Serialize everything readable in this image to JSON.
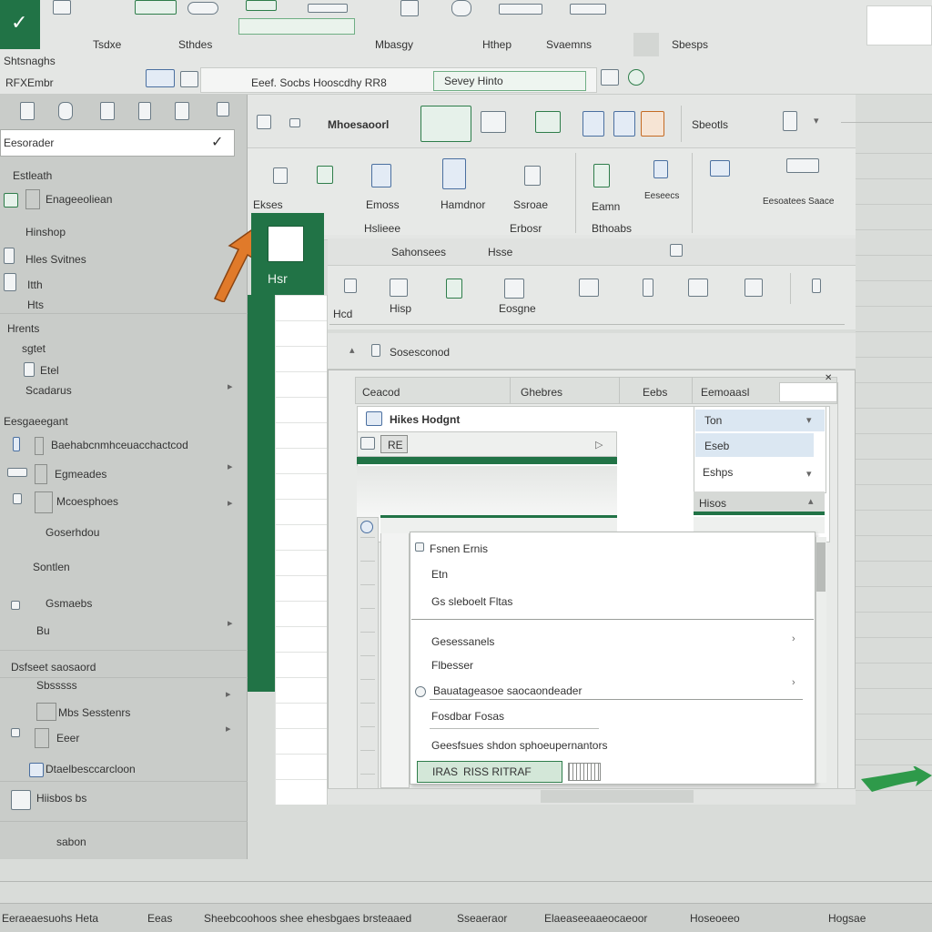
{
  "titlebar": {
    "logo_glyph": "✓",
    "menus": [
      "Tsdxe",
      "Sthdes",
      "Mbasgy",
      "Hthep",
      "Svaemns",
      "Sbesps"
    ]
  },
  "formula_bar": {
    "name_box": "Shtsnaghs",
    "sub_name": "RFXEmbr",
    "content": "Eeef. Socbs Hooscdhy RR8",
    "content2": "Sevey Hinto"
  },
  "left_pane": {
    "search_value": "Eesorader",
    "items": [
      {
        "label": "Estleath"
      },
      {
        "label": "Enageeoliean"
      },
      {
        "label": "Hinshop"
      },
      {
        "label": "Hles Svitnes"
      },
      {
        "label": "Itth"
      },
      {
        "label": "Hts"
      }
    ],
    "section2_title": "Hrents",
    "section2_items": [
      {
        "label": "sgtet"
      },
      {
        "label": "Etel"
      },
      {
        "label": "Scadarus"
      }
    ],
    "section3_title": "Eesgaeegant",
    "section3_items": [
      {
        "label": "Baehabcnmhceuacchactcod"
      },
      {
        "label": "Egmeades"
      },
      {
        "label": "Mcoesphoes"
      },
      {
        "label": "Goserhdou"
      },
      {
        "label": "Sontlen"
      },
      {
        "label": "Gsmaebs"
      },
      {
        "label": "Bu"
      }
    ],
    "section4_title": "Dsfseet saosaord",
    "section4_items": [
      {
        "label": "Sbsssss"
      },
      {
        "label": "Mbs Sesstenrs"
      },
      {
        "label": "Eeer"
      },
      {
        "label": "Dtaelbesccarcloon"
      },
      {
        "label": "Hiisbos bs"
      },
      {
        "label": "sabon"
      }
    ]
  },
  "ribbon": {
    "top_label": "Mhoesaoorl",
    "top_right_label": "Sbeotls",
    "groups": [
      {
        "label": "Emoss"
      },
      {
        "label": "Hamdnor"
      },
      {
        "label": "Ssroae"
      },
      {
        "label": "Eamn"
      },
      {
        "label": "Bthoabs"
      },
      {
        "label": "Eeseecs"
      },
      {
        "label": "Eesoatees Saace"
      }
    ],
    "group_captions": [
      "Ekses",
      "Hslieee",
      "Erbosr"
    ],
    "row2_label": "Sahonsees",
    "row2_label2": "Hsse",
    "excel_tile": "Hsr",
    "row3_labels": [
      "Hcd",
      "Hisp",
      "Eosgne"
    ],
    "breadcrumb": "Sosesconod"
  },
  "dialog": {
    "columns": [
      "Ceacod",
      "Ghebres",
      "Eebs",
      "Eemoaasl"
    ],
    "row1_label": "Hikes Hodgnt",
    "row2_label": "RE",
    "right_list": [
      "Ton",
      "Eseb",
      "Eshps",
      "Hisos"
    ]
  },
  "context_menu": {
    "items": [
      {
        "label": "Fsnen Ernis"
      },
      {
        "label": "Etn"
      },
      {
        "label": "Gs sleboelt Fltas"
      },
      {
        "label": "Gesessanels"
      },
      {
        "label": "Flbesser"
      },
      {
        "label": "Bauatageasoe saocaondeader"
      },
      {
        "label": "Fosdbar Fosas"
      },
      {
        "label": "Geesfsues shdon sphoeupernantors"
      }
    ],
    "buttons": [
      "IRAS",
      "RISS RITRAF"
    ]
  },
  "status_bar": {
    "segments": [
      "Eeraeaesuohs Heta",
      "Eeas",
      "Sheebcoohoos shee ehesbgaes brsteaaed",
      "Sseaeraor",
      "Elaeaseeaaeocaeoor",
      "Hoseoeeo",
      "Hogsae"
    ]
  },
  "colors": {
    "excel_green": "#217346",
    "accent_orange": "#e07a2a",
    "panel_bg": "#c9ccc9",
    "ribbon_bg": "#e4e6e4"
  }
}
